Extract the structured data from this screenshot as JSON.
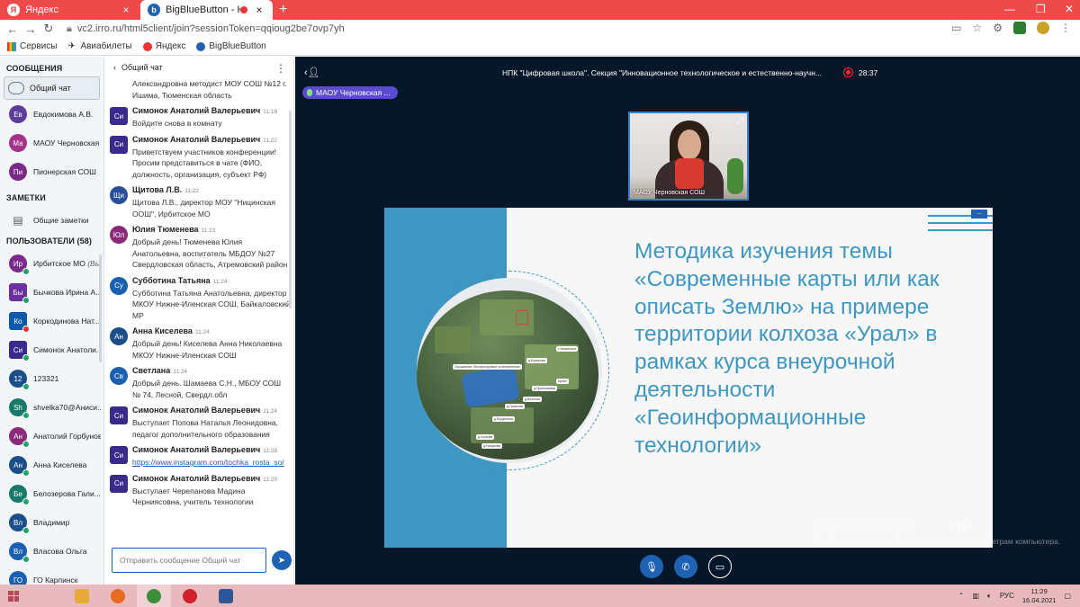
{
  "browser": {
    "tabs": [
      {
        "label": "Яндекс",
        "icon": "yandex-favicon"
      },
      {
        "label": "BigBlueButton - НПК \"Циф",
        "icon": "bbb-favicon",
        "recording": true
      }
    ],
    "url": "vc2.irro.ru/html5client/join?sessionToken=qqioug2be7ovp7yh",
    "bookmarks": [
      "Сервисы",
      "Авиабилеты",
      "Яндекс",
      "BigBlueButton"
    ]
  },
  "userlist": {
    "messages_title": "СООБЩЕНИЯ",
    "public_chat": "Общий чат",
    "private_chats": [
      {
        "initials": "Ев",
        "name": "Евдокимова А.В.",
        "color": "#5c3d99"
      },
      {
        "initials": "Ма",
        "name": "МАОУ Черновская ...",
        "color": "#a6328a"
      },
      {
        "initials": "Пи",
        "name": "Пионерская СОШ",
        "color": "#7a2a8a"
      }
    ],
    "notes_title": "ЗАМЕТКИ",
    "shared_notes": "Общие заметки",
    "users_title": "ПОЛЬЗОВАТЕЛИ (58)",
    "users": [
      {
        "initials": "Ир",
        "name": "Ирбитское МО",
        "you": "(Вы)",
        "color": "#7a2a8a",
        "mic": "#21a366",
        "sq": false
      },
      {
        "initials": "Бы",
        "name": "Бычкова Ирина А...",
        "color": "#6b2fa0",
        "mic": "#21a366",
        "sq": true
      },
      {
        "initials": "Ко",
        "name": "Коркодинова Нат...",
        "color": "#0f5aa8",
        "mic": "#d33",
        "sq": true
      },
      {
        "initials": "Си",
        "name": "Симонок Анатоли...",
        "color": "#3a2a8c",
        "mic": "#21a366",
        "sq": true
      },
      {
        "initials": "12",
        "name": "123321",
        "color": "#1c4f8a",
        "mic": "#21a366",
        "sq": false
      },
      {
        "initials": "Sh",
        "name": "shvelka70@Аниси...",
        "color": "#1a7a6a",
        "mic": "#21a366",
        "sq": false
      },
      {
        "initials": "Ан",
        "name": "Анатолий Горбунов",
        "color": "#8a2a7a",
        "mic": "#21a366",
        "sq": false
      },
      {
        "initials": "Ан",
        "name": "Анна Киселева",
        "color": "#1c4f8a",
        "mic": "#21a366",
        "sq": false
      },
      {
        "initials": "Бе",
        "name": "Белозерова Гали...",
        "color": "#1a7a6a",
        "mic": "#21a366",
        "sq": false
      },
      {
        "initials": "Вл",
        "name": "Владимир",
        "color": "#1c4f8a",
        "mic": "#21a366",
        "sq": false
      },
      {
        "initials": "Вл",
        "name": "Власова Ольга",
        "color": "#1a5fb0",
        "mic": "#21a366",
        "sq": false
      },
      {
        "initials": "ГО",
        "name": "ГО Карпинск",
        "color": "#1a5fb0",
        "mic": "#21a366",
        "sq": false
      }
    ]
  },
  "chat": {
    "title": "Общий чат",
    "placeholder": "Отправить сообщение Общий чат",
    "messages": [
      {
        "initials": "",
        "name": "",
        "time": "",
        "text": "Александровна методист МОУ СОШ №12 г. Ишима, Тюменская область",
        "color": "",
        "round": false
      },
      {
        "initials": "Си",
        "name": "Симонок Анатолий Валерьевич",
        "time": "11:18",
        "text": "Войдите снова в комнату",
        "color": "#3a2a8c",
        "round": false
      },
      {
        "initials": "Си",
        "name": "Симонок Анатолий Валерьевич",
        "time": "11:22",
        "text": "Приветствуем участников конференции! Просим представиться в чате (ФИО, должность, организация, субъект РФ)",
        "color": "#3a2a8c",
        "round": false
      },
      {
        "initials": "Щи",
        "name": "Щитова Л.В.",
        "time": "11:22",
        "text": "Щитова Л.В., директор МОУ \"Ницинская ООШ\", Ирбитское МО",
        "color": "#2a4f9a",
        "round": true
      },
      {
        "initials": "Юл",
        "name": "Юлия Тюменева",
        "time": "11:23",
        "text": "Добрый день! Тюменева Юлия Анатольевна, воспитатель МБДОУ №27 Свердловская область, Атремовский район",
        "color": "#8a2a7a",
        "round": true
      },
      {
        "initials": "Су",
        "name": "Субботина Татьяна",
        "time": "11:24",
        "text": "Субботина Татьяна Анатольевна, директор МКОУ Нижне-Иленская СОШ, Байкаловский МР",
        "color": "#1a5fb0",
        "round": true
      },
      {
        "initials": "Ан",
        "name": "Анна Киселева",
        "time": "11:24",
        "text": "Добрый день! Киселева Анна Николаевна МКОУ Нижне-Иленская СОШ",
        "color": "#1c4f8a",
        "round": true
      },
      {
        "initials": "Св",
        "name": "Светлана",
        "time": "11:24",
        "text": "Добрый день. Шамаева С.Н., МБОУ СОШ № 74, Лесной, Свердл.обл",
        "color": "#1a5fb0",
        "round": true
      },
      {
        "initials": "Си",
        "name": "Симонок Анатолий Валерьевич",
        "time": "11:24",
        "text": "Выступает Попова Наталья Леонидовна, педагог дополнительного образования",
        "color": "#3a2a8c",
        "round": false
      },
      {
        "initials": "Си",
        "name": "Симонок Анатолий Валерьевич",
        "time": "11:28",
        "text": "https://www.instagram.com/tochka_rosta_so/",
        "color": "#3a2a8c",
        "round": false,
        "link": true
      },
      {
        "initials": "Си",
        "name": "Симонок Анатолий Валерьевич",
        "time": "11:29",
        "text": "Выступает Черепанова Мадина Черниясовна, учитель технологии",
        "color": "#3a2a8c",
        "round": false
      }
    ]
  },
  "meeting": {
    "title": "НПК \"Цифровая школа\". Секция \"Инновационное технологическое и естественно-научн...",
    "timer": "28:37",
    "talker": "МАОУ Черновская ...",
    "webcam_label": "МАОУ Черновская СОШ",
    "slide_title": "Методика изучения темы «Современные карты или как описать Землю» на примере территории колхоза «Урал» в рамках курса внеурочной деятельности «Геоинформационные технологии»",
    "slide_btn": "...",
    "map_labels": [
      "Орошаемое Лесорнатуравое установленное",
      "с.Ницинское",
      "д.Бурыкова",
      "Ирбит",
      "д.Прокопьевка",
      "д.Вольная",
      "д.Грязнова",
      "д.Бердюгина",
      "д.Чучкова",
      "д.Назарова"
    ],
    "activation_title": "Активация Windows",
    "activation_text": "Чтобы активировать Windows, перейдите к параметрам компьютера."
  },
  "taskbar": {
    "lang": "РУС",
    "time": "11:29",
    "date": "16.04.2021",
    "apps": [
      {
        "name": "explorer",
        "color": "#e8a93a"
      },
      {
        "name": "firefox",
        "color": "#e66a1f"
      },
      {
        "name": "chrome",
        "color": "#3b8f3b"
      },
      {
        "name": "opera",
        "color": "#d0202a"
      },
      {
        "name": "word",
        "color": "#2b579a"
      }
    ]
  }
}
